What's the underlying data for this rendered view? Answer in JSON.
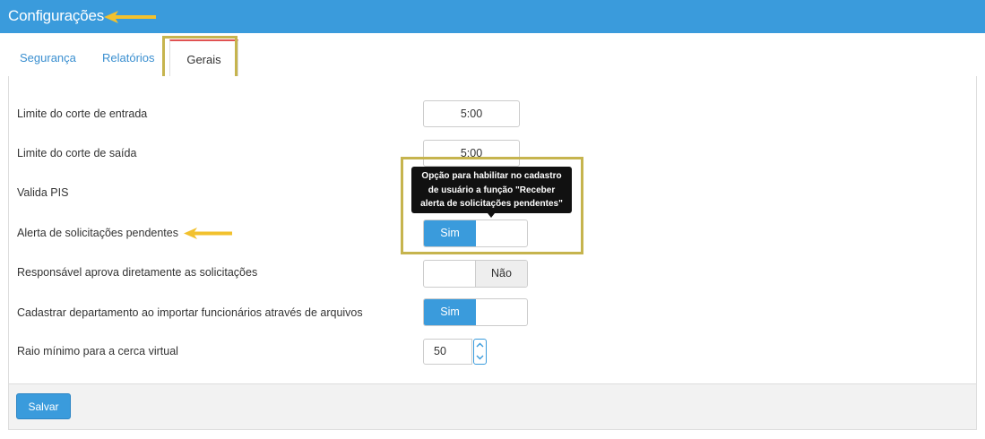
{
  "header": {
    "title": "Configurações"
  },
  "tabs": [
    {
      "label": "Segurança",
      "active": false
    },
    {
      "label": "Relatórios",
      "active": false
    },
    {
      "label": "Gerais",
      "active": true
    }
  ],
  "settings": {
    "corte_entrada": {
      "label": "Limite do corte de entrada",
      "value": "5:00"
    },
    "corte_saida": {
      "label": "Limite do corte de saída",
      "value": "5:00"
    },
    "valida_pis": {
      "label": "Valida PIS"
    },
    "alerta_solicitacoes": {
      "label": "Alerta de solicitações pendentes",
      "state_label": "Sim",
      "state": "on"
    },
    "responsavel_aprova": {
      "label": "Responsável aprova diretamente as solicitações",
      "state_label": "Não",
      "state": "off"
    },
    "cadastrar_departamento": {
      "label": "Cadastrar departamento ao importar funcionários através de arquivos",
      "state_label": "Sim",
      "state": "on"
    },
    "raio_minimo": {
      "label": "Raio mínimo para a cerca virtual",
      "value": "50"
    }
  },
  "tooltip": {
    "lines": [
      "Opção para habilitar no cadastro",
      "de usuário a função \"Receber",
      "alerta de solicitações pendentes\""
    ]
  },
  "footer": {
    "save_label": "Salvar"
  },
  "icons": {
    "arrow": "arrow-left-icon",
    "spinner_up": "chevron-up-icon",
    "spinner_down": "chevron-down-icon"
  },
  "colors": {
    "header": "#3a9bdc",
    "accent": "#3a9bdc",
    "highlight": "#c6b44e",
    "arrow": "#f2c12e",
    "active_tab_border": "#e05252"
  }
}
